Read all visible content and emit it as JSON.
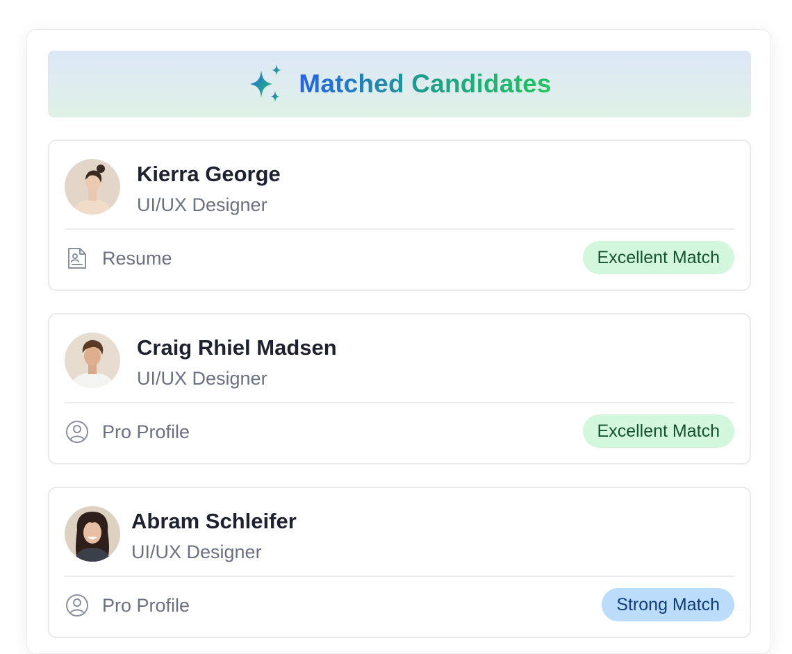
{
  "header": {
    "title": "Matched Candidates",
    "icon": "sparkle-icon"
  },
  "colors": {
    "title_gradient": [
      "#2563eb",
      "#22c55e"
    ],
    "excellent_bg": "#d3f7dd",
    "excellent_text": "#14532d",
    "strong_bg": "#bcdcfc",
    "strong_text": "#0f3d7a"
  },
  "candidates": [
    {
      "name": "Kierra George",
      "role": "UI/UX Designer",
      "link_label": "Resume",
      "link_icon": "resume-document-icon",
      "match_label": "Excellent Match",
      "match_level": "excellent"
    },
    {
      "name": "Craig Rhiel Madsen",
      "role": "UI/UX Designer",
      "link_label": "Pro Profile",
      "link_icon": "user-circle-icon",
      "match_label": "Excellent Match",
      "match_level": "excellent"
    },
    {
      "name": "Abram Schleifer",
      "role": "UI/UX Designer",
      "link_label": "Pro Profile",
      "link_icon": "user-circle-icon",
      "match_label": "Strong Match",
      "match_level": "strong"
    }
  ]
}
